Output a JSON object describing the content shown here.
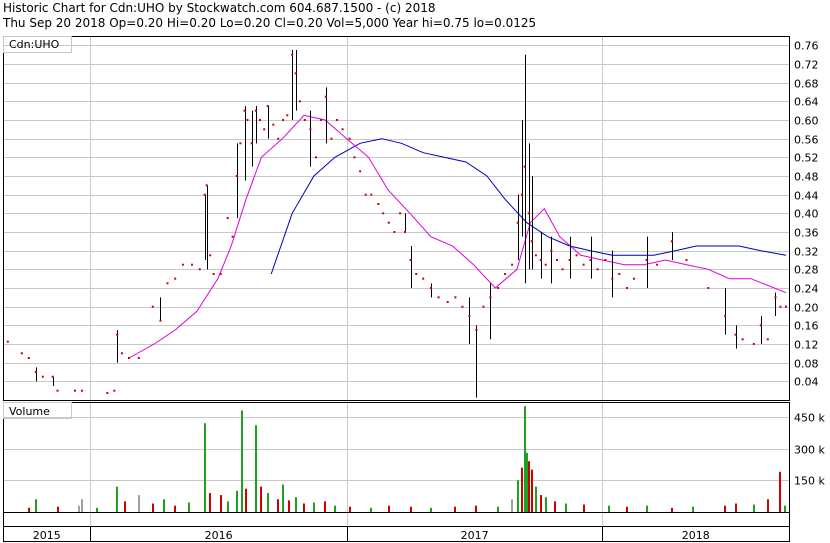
{
  "header": {
    "title": "Historic Chart for Cdn:UHO by Stockwatch.com 604.687.1500 - (c) 2018",
    "stats": "Thu Sep 20 2018  Op=0.20  Hi=0.20  Lo=0.20  Cl=0.20  Vol=5,000  Year hi=0.75  lo=0.0125"
  },
  "colors": {
    "background": "#ffffff",
    "frame": "#000000",
    "grid": "#c8c8c8",
    "price_bar": "#000000",
    "price_dot": "#d00000",
    "ma_short": "#e000e0",
    "ma_long": "#0000c0",
    "volume_up": "#20a020",
    "volume_down": "#d00000",
    "volume_flat": "#a0a0a0"
  },
  "chart_data": [
    {
      "type": "line",
      "panel": "price",
      "legend": "Cdn:UHO",
      "ylim": [
        0,
        0.78
      ],
      "yticks": [
        "0.04",
        "0.08",
        "0.12",
        "0.16",
        "0.20",
        "0.24",
        "0.28",
        "0.32",
        "0.36",
        "0.40",
        "0.44",
        "0.48",
        "0.52",
        "0.56",
        "0.60",
        "0.64",
        "0.68",
        "0.72",
        "0.76"
      ],
      "x_axis": {
        "start": "2015-09-01",
        "end": "2018-09-20",
        "year_labels": [
          {
            "label": "2015",
            "at": "2015-09-01"
          },
          {
            "label": "2016",
            "at": "2016-01-01"
          },
          {
            "label": "2017",
            "at": "2017-01-01"
          },
          {
            "label": "2018",
            "at": "2018-01-01"
          }
        ]
      },
      "grid": true,
      "price_points": [
        [
          "2015-09-05",
          0.125
        ],
        [
          "2015-09-25",
          0.1
        ],
        [
          "2015-10-05",
          0.09
        ],
        [
          "2015-10-15",
          0.06
        ],
        [
          "2015-10-25",
          0.05
        ],
        [
          "2015-11-08",
          0.05
        ],
        [
          "2015-11-15",
          0.02
        ],
        [
          "2015-12-10",
          0.02
        ],
        [
          "2015-12-20",
          0.02
        ],
        [
          "2016-01-25",
          0.015
        ],
        [
          "2016-02-04",
          0.02
        ],
        [
          "2016-02-08",
          0.14
        ],
        [
          "2016-02-15",
          0.1
        ],
        [
          "2016-02-25",
          0.09
        ],
        [
          "2016-03-10",
          0.09
        ],
        [
          "2016-03-30",
          0.2
        ],
        [
          "2016-04-10",
          0.17
        ],
        [
          "2016-04-20",
          0.25
        ],
        [
          "2016-05-01",
          0.26
        ],
        [
          "2016-05-12",
          0.29
        ],
        [
          "2016-05-25",
          0.29
        ],
        [
          "2016-06-05",
          0.28
        ],
        [
          "2016-06-12",
          0.44
        ],
        [
          "2016-06-15",
          0.46
        ],
        [
          "2016-06-20",
          0.31
        ],
        [
          "2016-06-25",
          0.27
        ],
        [
          "2016-07-05",
          0.27
        ],
        [
          "2016-07-15",
          0.39
        ],
        [
          "2016-07-22",
          0.35
        ],
        [
          "2016-07-28",
          0.48
        ],
        [
          "2016-08-02",
          0.55
        ],
        [
          "2016-08-08",
          0.62
        ],
        [
          "2016-08-12",
          0.6
        ],
        [
          "2016-08-18",
          0.55
        ],
        [
          "2016-08-24",
          0.62
        ],
        [
          "2016-08-30",
          0.6
        ],
        [
          "2016-09-05",
          0.58
        ],
        [
          "2016-09-10",
          0.63
        ],
        [
          "2016-09-18",
          0.59
        ],
        [
          "2016-09-25",
          0.56
        ],
        [
          "2016-10-02",
          0.6
        ],
        [
          "2016-10-08",
          0.61
        ],
        [
          "2016-10-15",
          0.74
        ],
        [
          "2016-10-20",
          0.7
        ],
        [
          "2016-10-26",
          0.64
        ],
        [
          "2016-11-02",
          0.6
        ],
        [
          "2016-11-10",
          0.58
        ],
        [
          "2016-11-18",
          0.52
        ],
        [
          "2016-11-25",
          0.6
        ],
        [
          "2016-12-02",
          0.65
        ],
        [
          "2016-12-10",
          0.56
        ],
        [
          "2016-12-18",
          0.6
        ],
        [
          "2016-12-26",
          0.58
        ],
        [
          "2017-01-05",
          0.56
        ],
        [
          "2017-01-12",
          0.52
        ],
        [
          "2017-01-20",
          0.49
        ],
        [
          "2017-01-28",
          0.44
        ],
        [
          "2017-02-05",
          0.44
        ],
        [
          "2017-02-15",
          0.42
        ],
        [
          "2017-02-22",
          0.4
        ],
        [
          "2017-03-02",
          0.38
        ],
        [
          "2017-03-10",
          0.36
        ],
        [
          "2017-03-18",
          0.4
        ],
        [
          "2017-03-25",
          0.36
        ],
        [
          "2017-04-02",
          0.3
        ],
        [
          "2017-04-10",
          0.27
        ],
        [
          "2017-04-20",
          0.26
        ],
        [
          "2017-05-01",
          0.24
        ],
        [
          "2017-05-12",
          0.22
        ],
        [
          "2017-05-25",
          0.21
        ],
        [
          "2017-06-05",
          0.22
        ],
        [
          "2017-06-15",
          0.2
        ],
        [
          "2017-06-25",
          0.18
        ],
        [
          "2017-07-05",
          0.15
        ],
        [
          "2017-07-15",
          0.2
        ],
        [
          "2017-07-25",
          0.22
        ],
        [
          "2017-08-05",
          0.24
        ],
        [
          "2017-08-15",
          0.27
        ],
        [
          "2017-08-25",
          0.29
        ],
        [
          "2017-09-02",
          0.38
        ],
        [
          "2017-09-08",
          0.44
        ],
        [
          "2017-09-12",
          0.5
        ],
        [
          "2017-09-18",
          0.4
        ],
        [
          "2017-09-22",
          0.34
        ],
        [
          "2017-09-28",
          0.31
        ],
        [
          "2017-10-05",
          0.3
        ],
        [
          "2017-10-12",
          0.29
        ],
        [
          "2017-10-20",
          0.32
        ],
        [
          "2017-10-28",
          0.3
        ],
        [
          "2017-11-05",
          0.28
        ],
        [
          "2017-11-15",
          0.3
        ],
        [
          "2017-11-25",
          0.31
        ],
        [
          "2017-12-05",
          0.29
        ],
        [
          "2017-12-15",
          0.3
        ],
        [
          "2017-12-25",
          0.28
        ],
        [
          "2018-01-05",
          0.3
        ],
        [
          "2018-01-15",
          0.26
        ],
        [
          "2018-01-25",
          0.27
        ],
        [
          "2018-02-05",
          0.24
        ],
        [
          "2018-02-15",
          0.26
        ],
        [
          "2018-03-05",
          0.3
        ],
        [
          "2018-03-20",
          0.29
        ],
        [
          "2018-04-10",
          0.34
        ],
        [
          "2018-05-01",
          0.3
        ],
        [
          "2018-06-01",
          0.24
        ],
        [
          "2018-06-25",
          0.18
        ],
        [
          "2018-07-10",
          0.14
        ],
        [
          "2018-07-20",
          0.13
        ],
        [
          "2018-08-05",
          0.12
        ],
        [
          "2018-08-15",
          0.16
        ],
        [
          "2018-08-25",
          0.13
        ],
        [
          "2018-09-05",
          0.22
        ],
        [
          "2018-09-12",
          0.2
        ],
        [
          "2018-09-20",
          0.2
        ]
      ],
      "price_ranges": [
        [
          "2015-10-15",
          0.04,
          0.07
        ],
        [
          "2015-11-08",
          0.03,
          0.05
        ],
        [
          "2016-02-08",
          0.08,
          0.15
        ],
        [
          "2016-04-10",
          0.17,
          0.22
        ],
        [
          "2016-06-12",
          0.3,
          0.44
        ],
        [
          "2016-06-15",
          0.28,
          0.46
        ],
        [
          "2016-07-28",
          0.39,
          0.55
        ],
        [
          "2016-08-08",
          0.47,
          0.63
        ],
        [
          "2016-08-18",
          0.5,
          0.62
        ],
        [
          "2016-08-24",
          0.55,
          0.63
        ],
        [
          "2016-09-10",
          0.56,
          0.63
        ],
        [
          "2016-10-15",
          0.6,
          0.75
        ],
        [
          "2016-10-20",
          0.62,
          0.75
        ],
        [
          "2016-11-10",
          0.5,
          0.62
        ],
        [
          "2016-12-02",
          0.55,
          0.67
        ],
        [
          "2017-03-25",
          0.36,
          0.4
        ],
        [
          "2017-04-02",
          0.24,
          0.33
        ],
        [
          "2017-05-01",
          0.22,
          0.25
        ],
        [
          "2017-06-25",
          0.12,
          0.22
        ],
        [
          "2017-07-05",
          0.005,
          0.16
        ],
        [
          "2017-07-25",
          0.13,
          0.25
        ],
        [
          "2017-09-02",
          0.3,
          0.44
        ],
        [
          "2017-09-08",
          0.35,
          0.6
        ],
        [
          "2017-09-12",
          0.25,
          0.74
        ],
        [
          "2017-09-18",
          0.28,
          0.55
        ],
        [
          "2017-09-22",
          0.28,
          0.48
        ],
        [
          "2017-10-05",
          0.26,
          0.36
        ],
        [
          "2017-10-20",
          0.25,
          0.35
        ],
        [
          "2017-11-15",
          0.26,
          0.35
        ],
        [
          "2017-12-15",
          0.26,
          0.35
        ],
        [
          "2018-01-15",
          0.22,
          0.32
        ],
        [
          "2018-03-05",
          0.24,
          0.35
        ],
        [
          "2018-04-10",
          0.3,
          0.36
        ],
        [
          "2018-06-25",
          0.14,
          0.24
        ],
        [
          "2018-07-10",
          0.11,
          0.16
        ],
        [
          "2018-08-15",
          0.12,
          0.18
        ],
        [
          "2018-09-05",
          0.18,
          0.23
        ]
      ],
      "ma_short": [
        [
          "2016-02-25",
          0.09
        ],
        [
          "2016-04-01",
          0.12
        ],
        [
          "2016-05-01",
          0.15
        ],
        [
          "2016-06-01",
          0.19
        ],
        [
          "2016-07-01",
          0.26
        ],
        [
          "2016-07-20",
          0.33
        ],
        [
          "2016-08-10",
          0.43
        ],
        [
          "2016-09-01",
          0.52
        ],
        [
          "2016-10-01",
          0.56
        ],
        [
          "2016-11-01",
          0.61
        ],
        [
          "2016-12-01",
          0.6
        ],
        [
          "2017-01-01",
          0.56
        ],
        [
          "2017-02-01",
          0.52
        ],
        [
          "2017-03-01",
          0.45
        ],
        [
          "2017-04-01",
          0.4
        ],
        [
          "2017-05-01",
          0.35
        ],
        [
          "2017-06-01",
          0.33
        ],
        [
          "2017-07-01",
          0.29
        ],
        [
          "2017-08-01",
          0.24
        ],
        [
          "2017-09-01",
          0.28
        ],
        [
          "2017-09-20",
          0.38
        ],
        [
          "2017-10-10",
          0.41
        ],
        [
          "2017-11-01",
          0.35
        ],
        [
          "2017-12-01",
          0.31
        ],
        [
          "2018-01-01",
          0.3
        ],
        [
          "2018-02-01",
          0.29
        ],
        [
          "2018-03-01",
          0.29
        ],
        [
          "2018-04-01",
          0.3
        ],
        [
          "2018-05-01",
          0.29
        ],
        [
          "2018-06-01",
          0.28
        ],
        [
          "2018-07-01",
          0.26
        ],
        [
          "2018-08-01",
          0.26
        ],
        [
          "2018-09-20",
          0.23
        ]
      ],
      "ma_long": [
        [
          "2016-09-15",
          0.27
        ],
        [
          "2016-10-15",
          0.4
        ],
        [
          "2016-11-15",
          0.48
        ],
        [
          "2016-12-15",
          0.52
        ],
        [
          "2017-01-20",
          0.55
        ],
        [
          "2017-02-20",
          0.56
        ],
        [
          "2017-03-20",
          0.55
        ],
        [
          "2017-04-20",
          0.53
        ],
        [
          "2017-05-20",
          0.52
        ],
        [
          "2017-06-20",
          0.51
        ],
        [
          "2017-07-20",
          0.48
        ],
        [
          "2017-08-15",
          0.43
        ],
        [
          "2017-09-15",
          0.38
        ],
        [
          "2017-10-15",
          0.35
        ],
        [
          "2017-11-15",
          0.33
        ],
        [
          "2017-12-15",
          0.32
        ],
        [
          "2018-01-15",
          0.31
        ],
        [
          "2018-02-15",
          0.31
        ],
        [
          "2018-03-15",
          0.31
        ],
        [
          "2018-04-15",
          0.32
        ],
        [
          "2018-05-15",
          0.33
        ],
        [
          "2018-06-15",
          0.33
        ],
        [
          "2018-07-15",
          0.33
        ],
        [
          "2018-08-15",
          0.32
        ],
        [
          "2018-09-20",
          0.31
        ]
      ]
    },
    {
      "type": "bar",
      "panel": "volume",
      "legend": "Volume",
      "ylim": [
        0,
        520
      ],
      "yticks": [
        "150 k",
        "300 k",
        "450 k"
      ],
      "bars": [
        [
          "2015-10-05",
          20,
          "down"
        ],
        [
          "2015-10-15",
          60,
          "up"
        ],
        [
          "2015-11-15",
          25,
          "down"
        ],
        [
          "2015-12-15",
          30,
          "flat"
        ],
        [
          "2015-12-20",
          60,
          "flat"
        ],
        [
          "2016-01-10",
          20,
          "up"
        ],
        [
          "2016-02-08",
          120,
          "up"
        ],
        [
          "2016-02-20",
          50,
          "down"
        ],
        [
          "2016-03-10",
          80,
          "flat"
        ],
        [
          "2016-03-30",
          40,
          "down"
        ],
        [
          "2016-04-15",
          60,
          "up"
        ],
        [
          "2016-05-01",
          30,
          "down"
        ],
        [
          "2016-05-20",
          45,
          "up"
        ],
        [
          "2016-06-12",
          420,
          "up"
        ],
        [
          "2016-06-20",
          90,
          "down"
        ],
        [
          "2016-07-05",
          80,
          "down"
        ],
        [
          "2016-07-15",
          50,
          "up"
        ],
        [
          "2016-07-28",
          100,
          "up"
        ],
        [
          "2016-08-05",
          480,
          "up"
        ],
        [
          "2016-08-10",
          110,
          "down"
        ],
        [
          "2016-08-24",
          410,
          "up"
        ],
        [
          "2016-09-01",
          120,
          "down"
        ],
        [
          "2016-09-10",
          90,
          "up"
        ],
        [
          "2016-09-25",
          60,
          "down"
        ],
        [
          "2016-10-02",
          130,
          "up"
        ],
        [
          "2016-10-10",
          55,
          "down"
        ],
        [
          "2016-10-20",
          70,
          "up"
        ],
        [
          "2016-11-01",
          40,
          "down"
        ],
        [
          "2016-11-15",
          45,
          "up"
        ],
        [
          "2016-12-01",
          50,
          "down"
        ],
        [
          "2016-12-15",
          30,
          "up"
        ],
        [
          "2017-01-05",
          25,
          "down"
        ],
        [
          "2017-02-05",
          20,
          "up"
        ],
        [
          "2017-03-02",
          30,
          "down"
        ],
        [
          "2017-04-02",
          25,
          "down"
        ],
        [
          "2017-05-01",
          20,
          "up"
        ],
        [
          "2017-06-05",
          25,
          "down"
        ],
        [
          "2017-07-05",
          30,
          "down"
        ],
        [
          "2017-08-05",
          25,
          "up"
        ],
        [
          "2017-08-25",
          60,
          "flat"
        ],
        [
          "2017-09-02",
          150,
          "up"
        ],
        [
          "2017-09-08",
          210,
          "down"
        ],
        [
          "2017-09-12",
          500,
          "up"
        ],
        [
          "2017-09-15",
          280,
          "up"
        ],
        [
          "2017-09-18",
          240,
          "down"
        ],
        [
          "2017-09-22",
          200,
          "down"
        ],
        [
          "2017-09-28",
          120,
          "up"
        ],
        [
          "2017-10-05",
          80,
          "down"
        ],
        [
          "2017-10-12",
          70,
          "up"
        ],
        [
          "2017-10-25",
          50,
          "down"
        ],
        [
          "2017-11-10",
          40,
          "up"
        ],
        [
          "2017-12-05",
          35,
          "down"
        ],
        [
          "2018-01-10",
          30,
          "up"
        ],
        [
          "2018-02-05",
          25,
          "down"
        ],
        [
          "2018-03-05",
          30,
          "up"
        ],
        [
          "2018-04-10",
          20,
          "down"
        ],
        [
          "2018-05-10",
          25,
          "up"
        ],
        [
          "2018-06-25",
          30,
          "down"
        ],
        [
          "2018-07-10",
          40,
          "down"
        ],
        [
          "2018-08-05",
          35,
          "up"
        ],
        [
          "2018-08-25",
          60,
          "down"
        ],
        [
          "2018-09-12",
          190,
          "down"
        ],
        [
          "2018-09-18",
          30,
          "up"
        ]
      ]
    }
  ]
}
